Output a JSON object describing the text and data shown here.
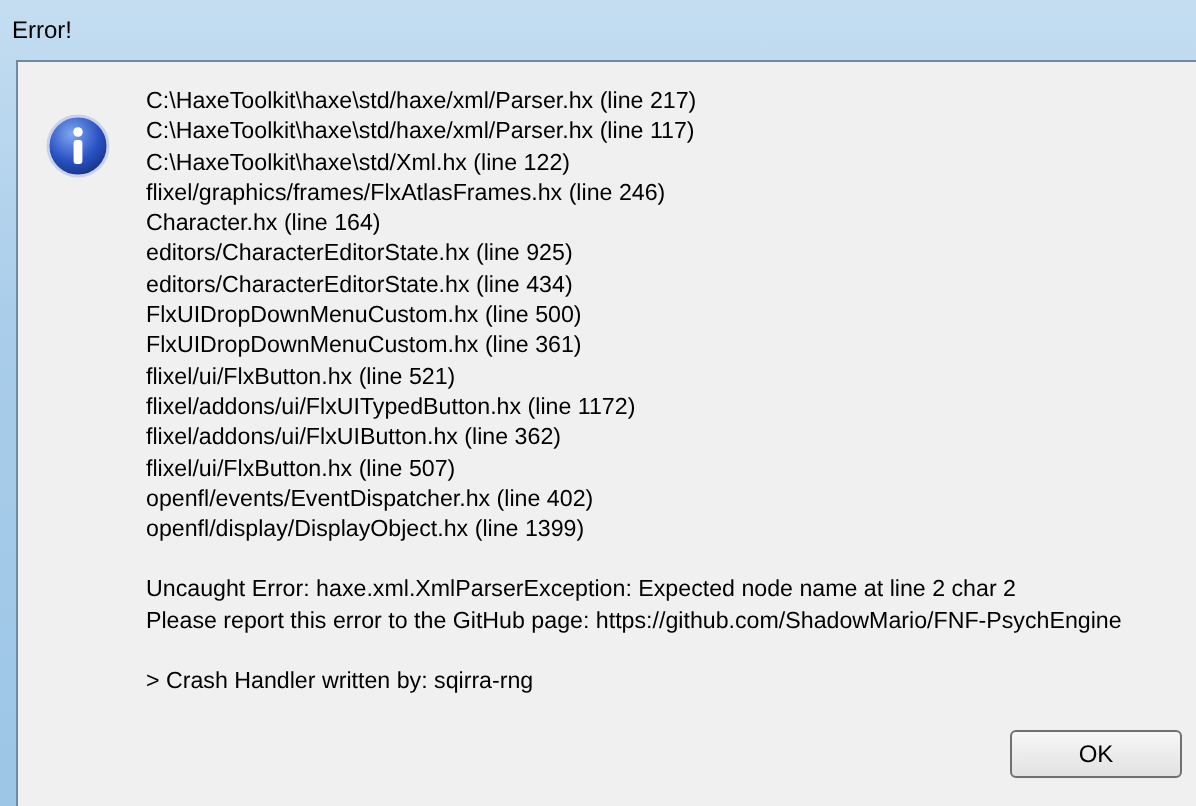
{
  "window": {
    "title": "Error!"
  },
  "stack_trace": [
    "C:\\HaxeToolkit\\haxe\\std/haxe/xml/Parser.hx (line 217)",
    "C:\\HaxeToolkit\\haxe\\std/haxe/xml/Parser.hx (line 117)",
    "C:\\HaxeToolkit\\haxe\\std/Xml.hx (line 122)",
    "flixel/graphics/frames/FlxAtlasFrames.hx (line 246)",
    "Character.hx (line 164)",
    "editors/CharacterEditorState.hx (line 925)",
    "editors/CharacterEditorState.hx (line 434)",
    "FlxUIDropDownMenuCustom.hx (line 500)",
    "FlxUIDropDownMenuCustom.hx (line 361)",
    "flixel/ui/FlxButton.hx (line 521)",
    "flixel/addons/ui/FlxUITypedButton.hx (line 1172)",
    "flixel/addons/ui/FlxUIButton.hx (line 362)",
    "flixel/ui/FlxButton.hx (line 507)",
    "openfl/events/EventDispatcher.hx (line 402)",
    "openfl/display/DisplayObject.hx (line 1399)"
  ],
  "error_lines": [
    "Uncaught Error: haxe.xml.XmlParserException: Expected node name at line 2 char 2",
    "Please report this error to the GitHub page: https://github.com/ShadowMario/FNF-PsychEngine"
  ],
  "credit": "> Crash Handler written by: sqirra-rng",
  "buttons": [
    "OK"
  ]
}
